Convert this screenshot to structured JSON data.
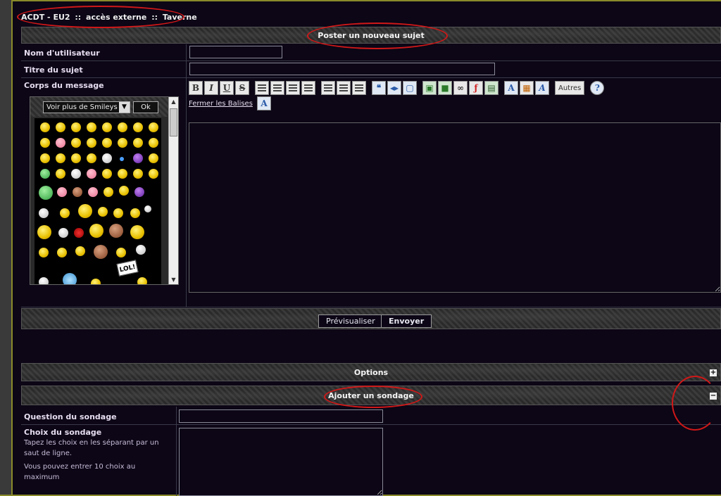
{
  "breadcrumb": {
    "forum": "ACDT - EU2",
    "sep1": "::",
    "section": "accès externe",
    "sep2": "::",
    "subsection": "Taverne"
  },
  "post_header": "Poster un nouveau sujet",
  "form": {
    "username_label": "Nom d'utilisateur",
    "username_value": "",
    "subject_label": "Titre du sujet",
    "subject_value": "",
    "body_label": "Corps du message",
    "body_value": ""
  },
  "smileys": {
    "select_value": "Voir plus de Smileys",
    "ok_label": "Ok",
    "lol_text": "LOL!"
  },
  "editor": {
    "bold": "B",
    "italic": "I",
    "underline": "U",
    "strike": "S",
    "others_label": "Autres",
    "close_tags": "Fermer les Balises",
    "font_glyph": "A"
  },
  "actions": {
    "preview_label": "Prévisualiser",
    "send_label": "Envoyer"
  },
  "options_header": "Options",
  "poll_header": "Ajouter un sondage",
  "poll": {
    "question_label": "Question du sondage",
    "question_value": "",
    "choices_label": "Choix du sondage",
    "choices_help_1": "Tapez les choix en les séparant par un saut de ligne.",
    "choices_help_2": "Vous pouvez entrer 10 choix au maximum",
    "choices_value": ""
  },
  "toggles": {
    "options": "+",
    "poll": "−"
  },
  "colors": {
    "background": "#0c0616",
    "annotation": "#d01818",
    "frame": "#8a8a2a"
  }
}
